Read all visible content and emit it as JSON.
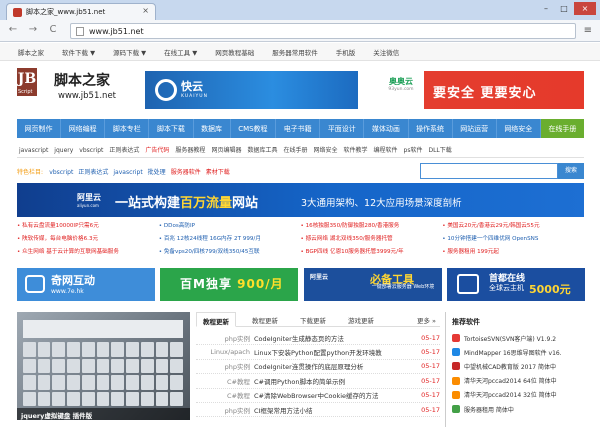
{
  "browser": {
    "tab_title": "脚本之家_www.jb51.net",
    "tab_close": "×",
    "url": "www.jb51.net",
    "back": "←",
    "forward": "→",
    "reload": "C",
    "menu": "≡",
    "win_min": "–",
    "win_max": "□",
    "win_close": "×"
  },
  "topnav": [
    "脚本之家",
    "软件下载 ▼",
    "源码下载 ▼",
    "在线工具 ▼",
    "网页教程基础",
    "服务器常用软件",
    "手机版",
    "关注微信"
  ],
  "logo": {
    "mark": "JB",
    "sub": "Script",
    "name": "脚本之家",
    "url": "www.jb51.net"
  },
  "ads": {
    "kuaiyun_title": "快云",
    "kuaiyun_sub": "KUAIYUN",
    "anquan_logo": "奥奥云",
    "anquan_logo_sub": "93yun.com",
    "anquan_text": "要安全 更要安心"
  },
  "bluenav": [
    "网页制作",
    "网络编程",
    "脚本专栏",
    "脚本下载",
    "数据库",
    "CMS教程",
    "电子书籍",
    "平面设计",
    "媒体动画",
    "操作系统",
    "网站运营",
    "网络安全",
    "在线手册"
  ],
  "subnav": [
    {
      "text": "javascript",
      "red": false
    },
    {
      "text": "jquery",
      "red": false
    },
    {
      "text": "vbscript",
      "red": false
    },
    {
      "text": "正则表达式",
      "red": false
    },
    {
      "text": "广告代码",
      "red": true
    },
    {
      "text": "服务器教程",
      "red": false
    },
    {
      "text": "网页编辑器",
      "red": false
    },
    {
      "text": "数据库工具",
      "red": false
    },
    {
      "text": "在线手册",
      "red": false
    },
    {
      "text": "网络安全",
      "red": false
    },
    {
      "text": "软件教学",
      "red": false
    },
    {
      "text": "编程软件",
      "red": false
    },
    {
      "text": "ps软件",
      "red": false
    },
    {
      "text": "DLL下载",
      "red": false
    }
  ],
  "featured": {
    "label": "特色栏目:",
    "items": [
      {
        "text": "vbscript",
        "red": false
      },
      {
        "text": "正则表达式",
        "red": false
      },
      {
        "text": "javascript",
        "red": false
      },
      {
        "text": "批处理",
        "red": false
      },
      {
        "text": "服务器软件",
        "red": true
      },
      {
        "text": "素材下载",
        "red": true
      }
    ]
  },
  "search": {
    "placeholder": "",
    "button": "搜索"
  },
  "banner": {
    "brand": "阿里云",
    "brand_sub": "aliyun.com",
    "headline_a": "一站式构建",
    "headline_b": "百万流量",
    "headline_c": "网站",
    "sub": "3大通用架构、12大应用场景深度剖析"
  },
  "links": [
    {
      "text": "• 私有云盘流量10000IP只需6元",
      "blue": false
    },
    {
      "text": "• DDos高防IP",
      "blue": true
    },
    {
      "text": "• 16核独服350/防御独服280/香港服务",
      "blue": false
    },
    {
      "text": "• 美国云20元/香港云29元/韩国云55元",
      "blue": false
    },
    {
      "text": "• 陕软传媒，每台电脑价格6.3元",
      "blue": false
    },
    {
      "text": "• 百兆 12核24线程 16G内存 2T 999/月",
      "blue": true
    },
    {
      "text": "• 撼云网络 湖北双线350/服务器托管",
      "blue": false
    },
    {
      "text": "• 10分钟搭建一个四维优网 OpenSNS",
      "blue": true
    },
    {
      "text": "• 众生网络 基于云计算的互联网基础服务",
      "blue": false
    },
    {
      "text": "• 免备vps20/四核799/双线350/45互联",
      "blue": true
    },
    {
      "text": "• BGP四线 亿恩10服务器托管3999元/年",
      "blue": false
    },
    {
      "text": "• 服务器租用 199元起",
      "blue": false
    }
  ],
  "tiles": {
    "t1_a": "奇网互动",
    "t1_b": "www.7e.hk",
    "t2_a": "百M独享",
    "t2_b": "900/月",
    "t3_logo": "阿里云",
    "t3_a": "必备工具",
    "t3_b": "一键部署云服务器 Web环境",
    "t4_a": "首都在线",
    "t4_b": "全球云主机",
    "t4_c": "5000元"
  },
  "keyboard_caption": "jquery虚拟键盘 插件版",
  "tabs": [
    "教程更新",
    "教程更新",
    "下载更新",
    "游戏更新",
    "更多 »"
  ],
  "articles": [
    {
      "cat": "php实例",
      "title": "CodeIgniter生成静态页的方法",
      "date": "05-17"
    },
    {
      "cat": "Linux/apach",
      "title": "Linux下安装Python配置python开发环境教",
      "date": "05-17"
    },
    {
      "cat": "php实例",
      "title": "CodeIgniter连贯操作的底层原理分析",
      "date": "05-17"
    },
    {
      "cat": "C#教程",
      "title": "C#调用Python脚本的简单示例",
      "date": "05-17"
    },
    {
      "cat": "C#教程",
      "title": "C#清除WebBrowser中Cookie缓存的方法",
      "date": "05-17"
    },
    {
      "cat": "php实例",
      "title": "CI框架常用方法小结",
      "date": "05-17"
    }
  ],
  "recommended": {
    "title": "推荐软件",
    "items": [
      {
        "text": "TortoiseSVN(SVN客户端) V1.9.2",
        "color": "#e53935"
      },
      {
        "text": "MindMapper 16思维导图软件 v16.",
        "color": "#1e88e5"
      },
      {
        "text": "中望机械CAD教育版 2017 简体中",
        "color": "#c62828"
      },
      {
        "text": "清华天河pccad2014 64位 简体中",
        "color": "#fb8c00"
      },
      {
        "text": "清华天河pccad2014 32位 简体中",
        "color": "#fb8c00"
      },
      {
        "text": "服务器租用 简体中",
        "color": "#43a047"
      }
    ]
  }
}
